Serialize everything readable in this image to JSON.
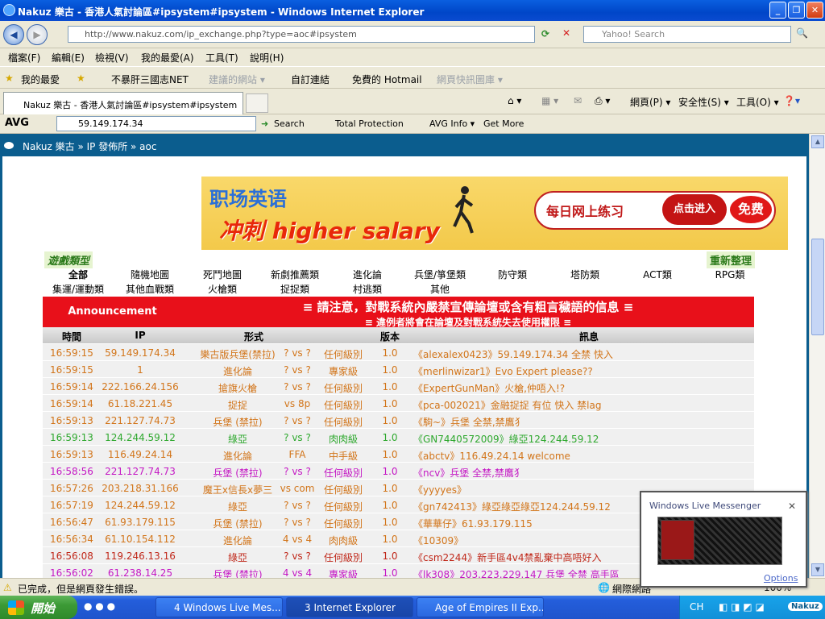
{
  "window": {
    "title": "Nakuz 樂古 - 香港人氣討論區#ipsystem#ipsystem - Windows Internet Explorer"
  },
  "address": {
    "url": "http://www.nakuz.com/ip_exchange.php?type=aoc#ipsystem",
    "search_placeholder": "Yahoo! Search"
  },
  "menu": [
    "檔案(F)",
    "編輯(E)",
    "檢視(V)",
    "我的最愛(A)",
    "工具(T)",
    "說明(H)"
  ],
  "favorites": {
    "label": "我的最愛",
    "items": [
      "不暴肝三國志NET",
      "建議的網站 ▾",
      "自訂連結",
      "免費的 Hotmail",
      "網頁快訊圖庫 ▾"
    ]
  },
  "tab": {
    "title": "Nakuz 樂古 - 香港人氣討論區#ipsystem#ipsystem"
  },
  "commandbar": {
    "page": "網頁(P) ▾",
    "safety": "安全性(S) ▾",
    "tools": "工具(O) ▾"
  },
  "avg": {
    "brand": "AVG",
    "search_value": "59.149.174.34",
    "search": "Search",
    "protection": "Total Protection",
    "info": "AVG Info ▾",
    "more": "Get More"
  },
  "breadcrumb": "Nakuz 樂古 » IP 發佈所 » aoc",
  "banner": {
    "line1": "职场英语",
    "line2": "冲刺 higher salary",
    "cta_text": "每日网上练习",
    "cta_button": "点击进入",
    "badge": "免费"
  },
  "game_type_label": "遊戲類型",
  "refresh_label": "重新整理",
  "categories_row1": [
    "全部",
    "隨機地圖",
    "死鬥地圖",
    "新劇推薦類",
    "進化論",
    "兵堡/箏堡類",
    "防守類",
    "塔防類",
    "ACT類",
    "RPG類"
  ],
  "categories_row2": [
    "集運/運動類",
    "其他血戰類",
    "火槍類",
    "捉捉類",
    "村逃類",
    "其他"
  ],
  "announcement": {
    "label": "Announcement",
    "line1": "≡ 請注意，對戰系統內嚴禁宣傳論壇或含有粗言穢語的信息 ≡",
    "line2": "≡ 違例者將會在論壇及對戰系統失去使用權限 ≡"
  },
  "table": {
    "headers": [
      "時間",
      "IP",
      "形式",
      "版本",
      "訊息"
    ],
    "rows": [
      {
        "time": "16:59:15",
        "ip": "59.149.174.34",
        "mode": "樂古版兵堡(禁拉)",
        "players": "? vs ?",
        "level": "任何級別",
        "ver": "1.0",
        "msg": "《alexalex0423》59.149.174.34 全禁 快入",
        "color": "#d2751a"
      },
      {
        "time": "16:59:15",
        "ip": "1",
        "mode": "進化論",
        "players": "? vs ?",
        "level": "專家級",
        "ver": "1.0",
        "msg": "《merlinwizar1》Evo Expert please??",
        "color": "#d2751a"
      },
      {
        "time": "16:59:14",
        "ip": "222.166.24.156",
        "mode": "搶旗火槍",
        "players": "? vs ?",
        "level": "任何級別",
        "ver": "1.0",
        "msg": "《ExpertGunMan》火槍,仲唔入!?",
        "color": "#d2751a"
      },
      {
        "time": "16:59:14",
        "ip": "61.18.221.45",
        "mode": "捉捉",
        "players": "vs 8p",
        "level": "任何級別",
        "ver": "1.0",
        "msg": "《pca-002021》金融捉捉 有位 快入 禁lag",
        "color": "#d2751a"
      },
      {
        "time": "16:59:13",
        "ip": "221.127.74.73",
        "mode": "兵堡 (禁拉)",
        "players": "? vs ?",
        "level": "任何級別",
        "ver": "1.0",
        "msg": "《駒~》兵堡 全禁,禁鷹犭",
        "color": "#d2751a"
      },
      {
        "time": "16:59:13",
        "ip": "124.244.59.12",
        "mode": "綠亞",
        "players": "? vs ?",
        "level": "肉肉級",
        "ver": "1.0",
        "msg": "《GN7440572009》綠亞124.244.59.12",
        "color": "#2ea82e"
      },
      {
        "time": "16:59:13",
        "ip": "116.49.24.14",
        "mode": "進化論",
        "players": "FFA",
        "level": "中手級",
        "ver": "1.0",
        "msg": "《abctv》116.49.24.14 welcome",
        "color": "#d2751a"
      },
      {
        "time": "16:58:56",
        "ip": "221.127.74.73",
        "mode": "兵堡 (禁拉)",
        "players": "? vs ?",
        "level": "任何級別",
        "ver": "1.0",
        "msg": "《ncv》兵堡 全禁,禁鷹犭",
        "color": "#c418c4"
      },
      {
        "time": "16:57:26",
        "ip": "203.218.31.166",
        "mode": "魔王x信長x夢三",
        "players": "vs com",
        "level": "任何級別",
        "ver": "1.0",
        "msg": "《yyyyes》",
        "color": "#d2751a"
      },
      {
        "time": "16:57:19",
        "ip": "124.244.59.12",
        "mode": "綠亞",
        "players": "? vs ?",
        "level": "任何級別",
        "ver": "1.0",
        "msg": "《gn742413》綠亞綠亞綠亞124.244.59.12",
        "color": "#d2751a"
      },
      {
        "time": "16:56:47",
        "ip": "61.93.179.115",
        "mode": "兵堡 (禁拉)",
        "players": "? vs ?",
        "level": "任何級別",
        "ver": "1.0",
        "msg": "《華華仔》61.93.179.115",
        "color": "#d2751a"
      },
      {
        "time": "16:56:34",
        "ip": "61.10.154.112",
        "mode": "進化論",
        "players": "4 vs 4",
        "level": "肉肉級",
        "ver": "1.0",
        "msg": "《10309》",
        "color": "#d2751a"
      },
      {
        "time": "16:56:08",
        "ip": "119.246.13.16",
        "mode": "綠亞",
        "players": "? vs ?",
        "level": "任何級別",
        "ver": "1.0",
        "msg": "《csm2244》新手區4v4禁亂棄中高唔好入",
        "color": "#c0281a"
      },
      {
        "time": "16:56:02",
        "ip": "61.238.14.25",
        "mode": "兵堡 (禁拉)",
        "players": "4 vs 4",
        "level": "專家級",
        "ver": "1.0",
        "msg": "《lk308》203.223.229.147 兵堡 全禁 高手區",
        "color": "#c418c4"
      }
    ]
  },
  "status": {
    "text": "已完成，但是網頁發生錯誤。",
    "zone": "網際網路",
    "zoom": "100%"
  },
  "messenger": {
    "title": "Windows Live Messenger",
    "options": "Options"
  },
  "taskbar": {
    "start": "開始",
    "tasks": [
      "4 Windows Live Mes...",
      "3 Internet Explorer",
      "Age of Empires II Exp..."
    ],
    "lang": "CH",
    "clock": "Nakuz"
  }
}
